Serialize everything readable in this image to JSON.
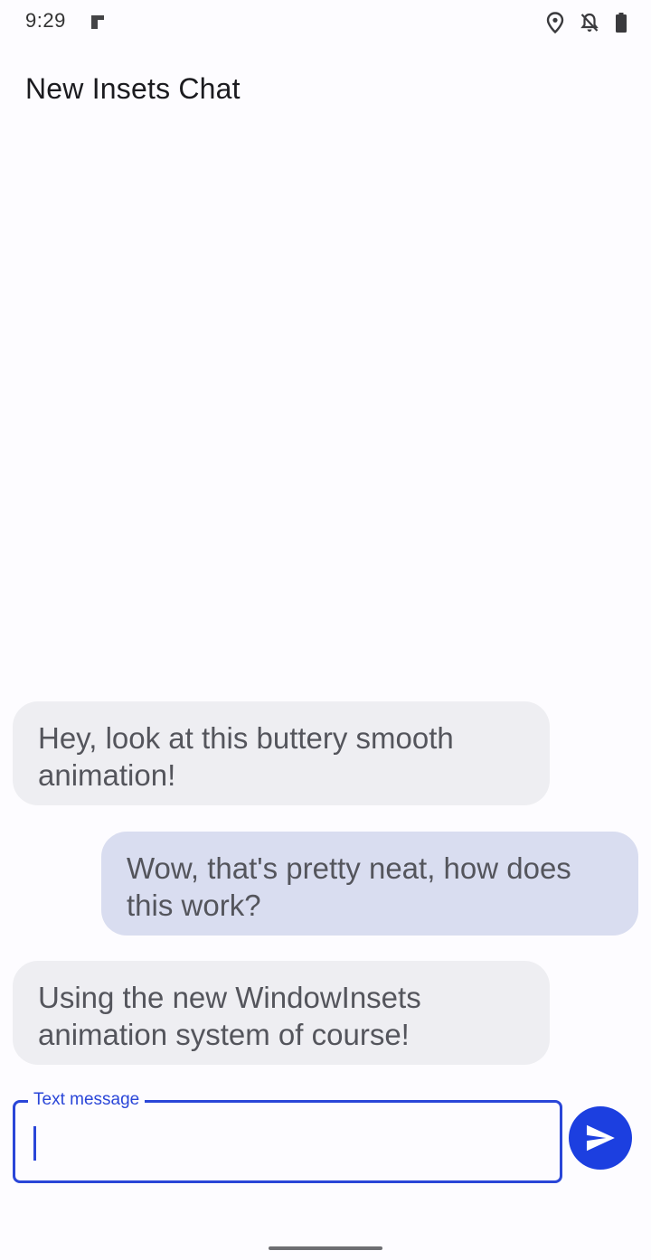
{
  "status_bar": {
    "time": "9:29",
    "icons": [
      "app-notification-icon",
      "location-icon",
      "notifications-off-icon",
      "battery-icon"
    ]
  },
  "app": {
    "title": "New Insets Chat"
  },
  "messages": [
    {
      "direction": "incoming",
      "text": "Hey, look at this buttery smooth animation!"
    },
    {
      "direction": "outgoing",
      "text": "Wow, that's pretty neat, how does this work?"
    },
    {
      "direction": "incoming",
      "text": "Using the new WindowInsets animation system of course!"
    }
  ],
  "composer": {
    "label": "Text message",
    "value": "",
    "send_icon": "send-icon"
  },
  "colors": {
    "accent": "#2A46D8",
    "send_button": "#1C3FE0",
    "incoming_bubble": "#EEEEF2",
    "outgoing_bubble": "#D9DDF0"
  }
}
